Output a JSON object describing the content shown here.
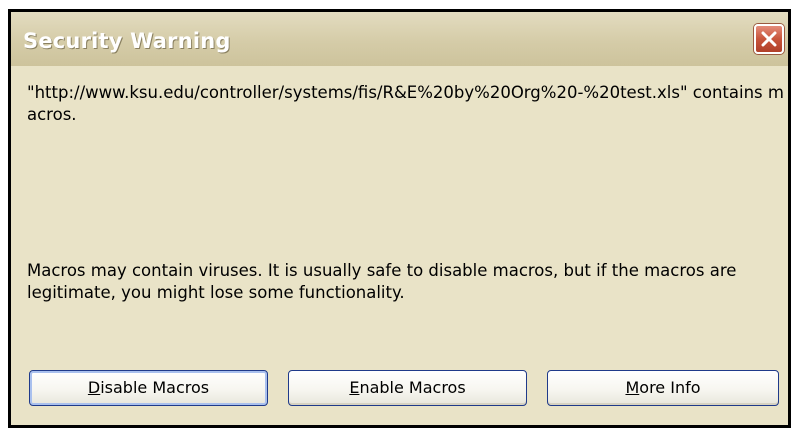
{
  "dialog": {
    "title": "Security Warning",
    "close_label": "✕"
  },
  "message": {
    "url_text": "\"http://www.ksu.edu/controller/systems/fis/R&E%20by%20Org%20-%20test.xls\" contains macros.",
    "warning_text": "Macros may contain viruses. It is usually safe to disable macros, but if the macros are legitimate, you might lose some functionality."
  },
  "buttons": {
    "disable": {
      "mnemonic": "D",
      "rest": "isable Macros"
    },
    "enable": {
      "mnemonic": "E",
      "rest": "nable Macros"
    },
    "more_info": {
      "mnemonic": "M",
      "rest": "ore Info"
    }
  },
  "colors": {
    "dialog_bg": "#e9e3c7",
    "close_button": "#c8553c",
    "button_border": "#1f3a8a"
  },
  "icons": {
    "close": "close-icon"
  }
}
